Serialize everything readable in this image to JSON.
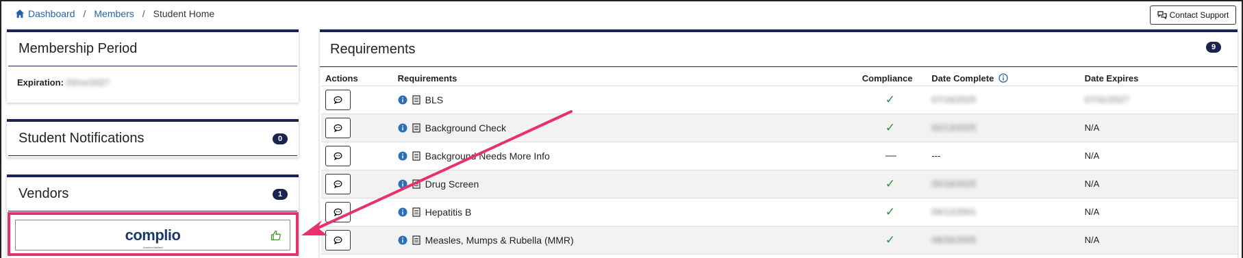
{
  "breadcrumb": {
    "items": [
      {
        "label": "Dashboard"
      },
      {
        "label": "Members"
      }
    ],
    "current": "Student Home",
    "separator": "/"
  },
  "contact_support": {
    "label": "Contact Support"
  },
  "membership": {
    "title": "Membership Period",
    "expiration_label": "Expiration:",
    "expiration_value": "03/xx/2027"
  },
  "notifications": {
    "title": "Student Notifications",
    "count": "0"
  },
  "vendors": {
    "title": "Vendors",
    "count": "1",
    "items": [
      {
        "name": "complio",
        "tagline": "American DataBank"
      }
    ]
  },
  "requirements": {
    "title": "Requirements",
    "count": "9",
    "columns": {
      "actions": "Actions",
      "requirements": "Requirements",
      "compliance": "Compliance",
      "date_complete": "Date Complete",
      "date_expires": "Date Expires"
    },
    "rows": [
      {
        "name": "BLS",
        "compliance": "✓",
        "date_complete": "07/16/2025",
        "date_expires": "07/31/2027",
        "expires_blurred": true
      },
      {
        "name": "Background Check",
        "compliance": "✓",
        "date_complete": "02/13/2025",
        "date_expires": "N/A",
        "expires_blurred": false
      },
      {
        "name": "Background Needs More Info",
        "compliance": "—",
        "date_complete": "---",
        "date_expires": "N/A",
        "expires_blurred": false
      },
      {
        "name": "Drug Screen",
        "compliance": "✓",
        "date_complete": "05/16/2025",
        "date_expires": "N/A",
        "expires_blurred": false
      },
      {
        "name": "Hepatitis B",
        "compliance": "✓",
        "date_complete": "09/12/2001",
        "date_expires": "N/A",
        "expires_blurred": false
      },
      {
        "name": "Measles, Mumps & Rubella (MMR)",
        "compliance": "✓",
        "date_complete": "08/26/2005",
        "date_expires": "N/A",
        "expires_blurred": false
      }
    ]
  },
  "colors": {
    "accent_navy": "#1b2451",
    "link_blue": "#2563a8",
    "check_green": "#2e8b3e",
    "highlight_pink": "#e6316b"
  },
  "icons": [
    "home-icon",
    "chat-icon",
    "info-icon",
    "document-icon",
    "thumbs-up-icon",
    "arrow-annotation"
  ]
}
